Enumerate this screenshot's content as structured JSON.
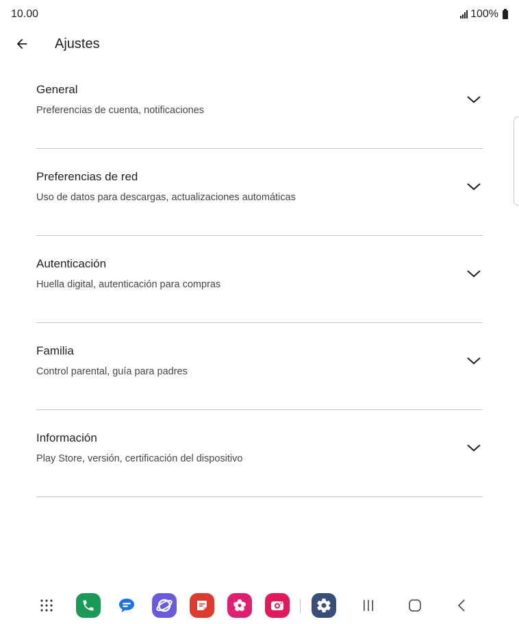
{
  "status": {
    "time": "10.00",
    "battery": "100%"
  },
  "header": {
    "title": "Ajustes"
  },
  "settings": [
    {
      "title": "General",
      "subtitle": "Preferencias de cuenta, notificaciones"
    },
    {
      "title": "Preferencias de red",
      "subtitle": "Uso de datos para descargas, actualizaciones automáticas"
    },
    {
      "title": "Autenticación",
      "subtitle": "Huella digital, autenticación para compras"
    },
    {
      "title": "Familia",
      "subtitle": "Control parental, guía para padres"
    },
    {
      "title": "Información",
      "subtitle": "Play Store, versión, certificación del dispositivo"
    }
  ],
  "icons": {
    "back": "arrow-left-icon",
    "expand": "chevron-down-icon",
    "taskbar": [
      "apps-grid-icon",
      "phone-icon",
      "messages-icon",
      "internet-icon",
      "notes-icon",
      "bixby-flower-icon",
      "camera-icon",
      "settings-gear-icon",
      "recent-apps-icon",
      "home-icon",
      "back-nav-icon"
    ]
  },
  "colors": {
    "phone": "#1a9b55",
    "messages": "#1a73e8",
    "internet": "#6a5ae0",
    "notes": "#e03a2f",
    "flower": "#e0206f",
    "camera": "#e3195a",
    "settings": "#3a4e7a",
    "divider": "#c7c7c7"
  }
}
